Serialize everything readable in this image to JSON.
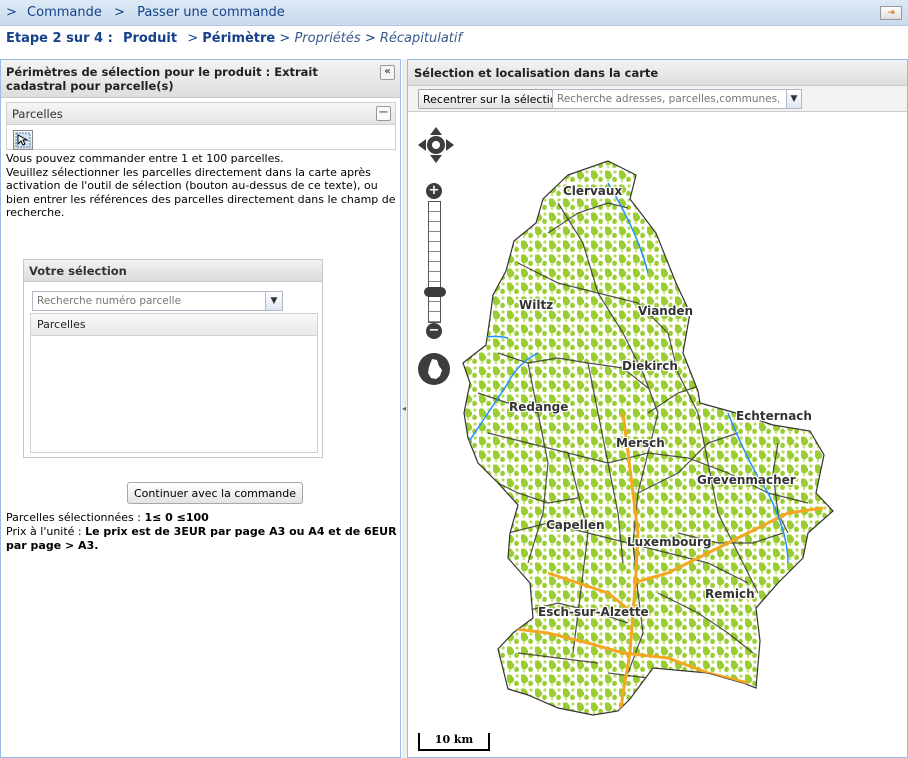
{
  "breadcrumb": {
    "prefix": ">",
    "items": [
      "Commande",
      "Passer une commande"
    ]
  },
  "steps": {
    "label": "Etape 2 sur 4 :",
    "step1": "Produit",
    "step2": "Périmètre",
    "step3": "Propriétés",
    "step4": "Récapitulatif",
    "sep": ">"
  },
  "left_panel": {
    "title": "Périmètres de sélection pour le produit : Extrait cadastral pour parcelle(s)",
    "collapse_glyph": "«",
    "parcels_section": {
      "title": "Parcelles",
      "minus_glyph": "−"
    },
    "help_line1": "Vous pouvez commander entre 1 et 100 parcelles.",
    "help_line2": "Veuillez sélectionner les parcelles directement dans la carte après activation de l'outil de sélection (bouton au-dessus de ce texte), ou bien entrer les références des parcelles directement dans le champ de recherche.",
    "selection": {
      "title": "Votre sélection",
      "search_placeholder": "Recherche numéro parcelle",
      "grid_header": "Parcelles"
    },
    "continue_label": "Continuer avec la commande",
    "summary": {
      "selected_label": "Parcelles sélectionnées :",
      "selected_value": "1≤ 0 ≤100",
      "price_label": "Prix à l'unité :",
      "price_value": "Le prix est de 3EUR par page A3 ou A4 et de 6EUR par page > A3."
    }
  },
  "right_panel": {
    "title": "Sélection et localisation dans la carte",
    "recenter_label": "Recentrer sur la sélection",
    "search_placeholder": "Recherche adresses, parcelles,communes, localités",
    "towns": [
      {
        "name": "Clervaux"
      },
      {
        "name": "Wiltz"
      },
      {
        "name": "Vianden"
      },
      {
        "name": "Diekirch"
      },
      {
        "name": "Redange"
      },
      {
        "name": "Echternach"
      },
      {
        "name": "Mersch"
      },
      {
        "name": "Grevenmacher"
      },
      {
        "name": "Capellen"
      },
      {
        "name": "Luxembourg"
      },
      {
        "name": "Remich"
      },
      {
        "name": "Esch-sur-Alzette"
      }
    ],
    "scale_label": "10 km"
  },
  "colors": {
    "accent": "#15428b",
    "forest": "#9acd32",
    "road_major": "#f5a623",
    "road_minor": "#333333",
    "water": "#1e90ff"
  }
}
